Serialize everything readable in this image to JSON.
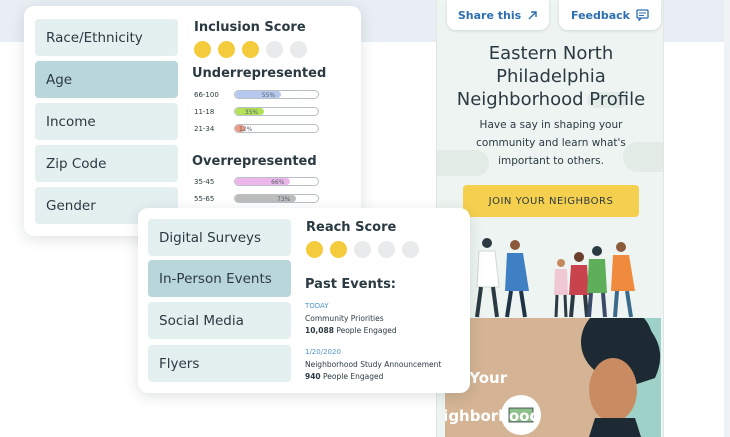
{
  "phone": {
    "share_label": "Share this",
    "feedback_label": "Feedback",
    "title_line1": "Eastern North",
    "title_line2": "Philadelphia",
    "title_line3": "Neighborhood Profile",
    "subtitle_line1": "Have a say in shaping your",
    "subtitle_line2": "community and learn what's",
    "subtitle_line3": "important to others.",
    "join_label": "JOIN YOUR NEIGHBORS",
    "hero_line1": "ape Your",
    "hero_line2": "eighborhood"
  },
  "demographics": {
    "items": [
      "Race/Ethnicity",
      "Age",
      "Income",
      "Zip Code",
      "Gender"
    ],
    "active_index": 1,
    "score_title": "Inclusion Score",
    "score_filled": 3,
    "score_total": 5,
    "under_title": "Underrepresented",
    "under_rows": [
      {
        "label": "66-100",
        "pct": "55%",
        "value": 55,
        "color": "#b6c8ee"
      },
      {
        "label": "11-18",
        "pct": "35%",
        "value": 35,
        "color": "#b4e05a"
      },
      {
        "label": "21-34",
        "pct": "12%",
        "value": 12,
        "color": "#ec9a86"
      }
    ],
    "over_title": "Overrepresented",
    "over_rows": [
      {
        "label": "35-45",
        "pct": "66%",
        "value": 66,
        "color": "#ecb6ea"
      },
      {
        "label": "55-65",
        "pct": "73%",
        "value": 73,
        "color": "#bcbcbc"
      }
    ]
  },
  "channels": {
    "items": [
      "Digital Surveys",
      "In-Person Events",
      "Social Media",
      "Flyers"
    ],
    "active_index": 1,
    "score_title": "Reach Score",
    "score_filled": 2,
    "score_total": 5,
    "events_title": "Past Events:",
    "events": [
      {
        "date": "TODAY",
        "name": "Community Priorities",
        "count": "10,088",
        "suffix": "People Engaged"
      },
      {
        "date": "1/20/2020",
        "name": "Neighborhood Study Announcement",
        "count": "940",
        "suffix": "People Engaged"
      }
    ]
  },
  "colors": {
    "active_nav": "#b9d6da",
    "inactive_nav": "#e4eff0",
    "score_dot": "#f4cb3c",
    "join_button": "#f5cf4e",
    "link_blue": "#2d6fb0"
  }
}
